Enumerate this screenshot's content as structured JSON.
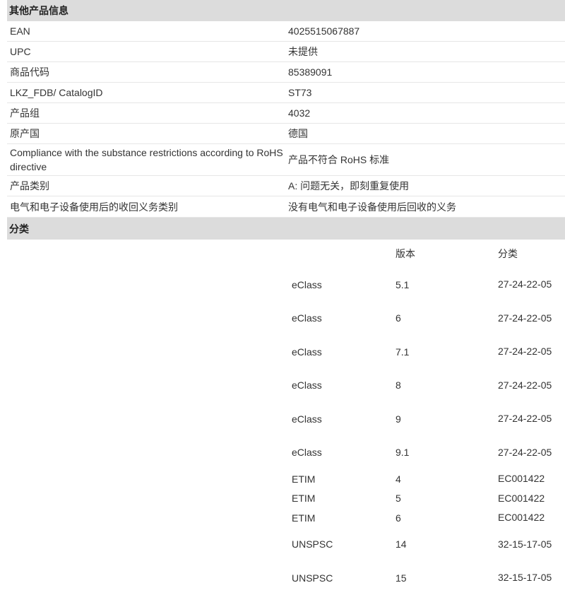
{
  "other_info": {
    "title": "其他产品信息",
    "rows": [
      {
        "label": "EAN",
        "value": "4025515067887"
      },
      {
        "label": "UPC",
        "value": "未提供"
      },
      {
        "label": "商品代码",
        "value": "85389091"
      },
      {
        "label": "LKZ_FDB/ CatalogID",
        "value": "ST73"
      },
      {
        "label": "产品组",
        "value": "4032"
      },
      {
        "label": "原产国",
        "value": "德国"
      },
      {
        "label": "Compliance with the substance restrictions according to RoHS directive",
        "value": "产品不符合 RoHS 标准"
      },
      {
        "label": "产品类别",
        "value": "A: 问题无关，即刻重复使用"
      },
      {
        "label": "电气和电子设备使用后的收回义务类别",
        "value": "没有电气和电子设备使用后回收的义务"
      }
    ]
  },
  "classification": {
    "title": "分类",
    "headers": {
      "version": "版本",
      "class": "分类"
    },
    "rows": [
      {
        "system": "eClass",
        "version": "5.1",
        "code": "27-24-22-05"
      },
      {
        "system": "eClass",
        "version": "6",
        "code": "27-24-22-05"
      },
      {
        "system": "eClass",
        "version": "7.1",
        "code": "27-24-22-05"
      },
      {
        "system": "eClass",
        "version": "8",
        "code": "27-24-22-05"
      },
      {
        "system": "eClass",
        "version": "9",
        "code": "27-24-22-05"
      },
      {
        "system": "eClass",
        "version": "9.1",
        "code": "27-24-22-05"
      },
      {
        "system": "ETIM",
        "version": "4",
        "code": "EC001422"
      },
      {
        "system": "ETIM",
        "version": "5",
        "code": "EC001422"
      },
      {
        "system": "ETIM",
        "version": "6",
        "code": "EC001422"
      },
      {
        "system": "UNSPSC",
        "version": "14",
        "code": "32-15-17-05"
      },
      {
        "system": "UNSPSC",
        "version": "15",
        "code": "32-15-17-05"
      }
    ]
  }
}
